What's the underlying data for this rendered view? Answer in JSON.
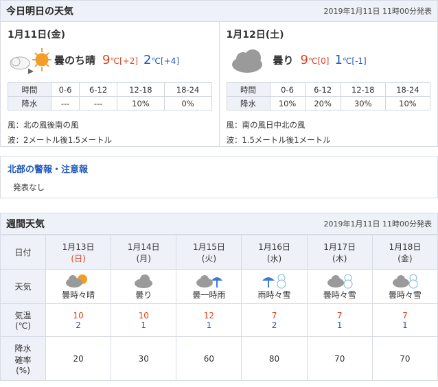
{
  "today_section": {
    "title": "今日明日の天気",
    "issued": "2019年1月11日 11時00分発表"
  },
  "days": [
    {
      "date": "1月11日(金)",
      "weather": "曇のち晴",
      "hi": "9",
      "hi_unit": "℃",
      "hi_diff": "[+2]",
      "lo": "2",
      "lo_unit": "℃",
      "lo_diff": "[+4]",
      "rain_header": [
        "時間",
        "0-6",
        "6-12",
        "12-18",
        "18-24"
      ],
      "rain_row": [
        "降水",
        "---",
        "---",
        "10%",
        "0%"
      ],
      "wind": "風：北の風後南の風",
      "wave": "波：2メートル後1.5メートル",
      "icon": "cloud-then-sun-icon"
    },
    {
      "date": "1月12日(土)",
      "weather": "曇り",
      "hi": "9",
      "hi_unit": "℃",
      "hi_diff": "[0]",
      "lo": "1",
      "lo_unit": "℃",
      "lo_diff": "[-1]",
      "rain_header": [
        "時間",
        "0-6",
        "6-12",
        "12-18",
        "18-24"
      ],
      "rain_row": [
        "降水",
        "10%",
        "20%",
        "30%",
        "10%"
      ],
      "wind": "風：南の風日中北の風",
      "wave": "波：1.5メートル後1メートル",
      "icon": "cloud-icon"
    }
  ],
  "warning": {
    "title": "北部の警報・注意報",
    "body": "発表なし"
  },
  "week_section": {
    "title": "週間天気",
    "issued": "2019年1月11日 11時00分発表"
  },
  "week": {
    "row_labels": {
      "date": "日付",
      "weather": "天気",
      "temp": "気温\n(℃)",
      "rain": "降水\n確率\n(%)"
    },
    "cols": [
      {
        "date": "1月13日",
        "wd": "(日)",
        "weather": "曇時々晴",
        "hi": "10",
        "lo": "2",
        "rain": "20",
        "icon": "cloud-sun-icon"
      },
      {
        "date": "1月14日",
        "wd": "(月)",
        "weather": "曇り",
        "hi": "10",
        "lo": "1",
        "rain": "30",
        "icon": "cloud-icon"
      },
      {
        "date": "1月15日",
        "wd": "(火)",
        "weather": "曇一時雨",
        "hi": "12",
        "lo": "1",
        "rain": "60",
        "icon": "cloud-umbrella-icon"
      },
      {
        "date": "1月16日",
        "wd": "(水)",
        "weather": "雨時々雪",
        "hi": "7",
        "lo": "2",
        "rain": "80",
        "icon": "umbrella-snowman-icon"
      },
      {
        "date": "1月17日",
        "wd": "(木)",
        "weather": "曇時々雪",
        "hi": "7",
        "lo": "1",
        "rain": "70",
        "icon": "cloud-snowman-icon"
      },
      {
        "date": "1月18日",
        "wd": "(金)",
        "weather": "曇時々雪",
        "hi": "7",
        "lo": "1",
        "rain": "70",
        "icon": "cloud-snowman-icon"
      }
    ]
  },
  "colors": {
    "header_bg": "#eef1f8",
    "hot": "#e0411d",
    "cold": "#1f57b8",
    "border": "#d7dbe6"
  }
}
